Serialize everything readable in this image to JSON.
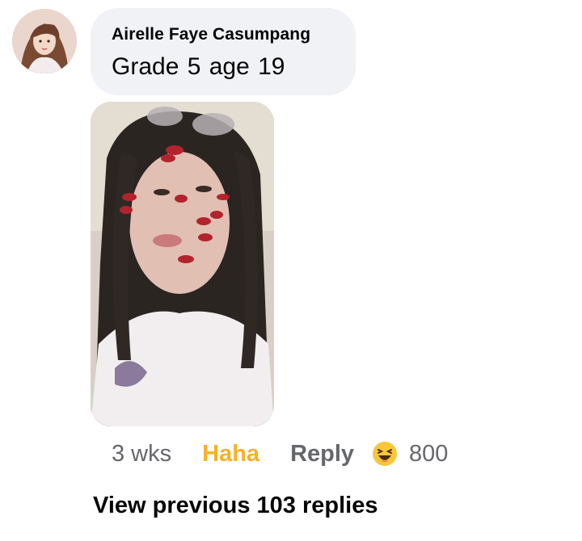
{
  "comment": {
    "author": "Airelle Faye Casumpang",
    "text": "Grade 5  age 19",
    "time": "3 wks",
    "reaction_label": "Haha",
    "reply_label": "Reply",
    "reaction_icon": "haha-emoji-icon",
    "reaction_count": "800"
  },
  "thread": {
    "view_previous": "View previous 103 replies"
  },
  "colors": {
    "bubble": "#f0f2f5",
    "haha": "#f7b125",
    "secondary_text": "#65676b"
  }
}
